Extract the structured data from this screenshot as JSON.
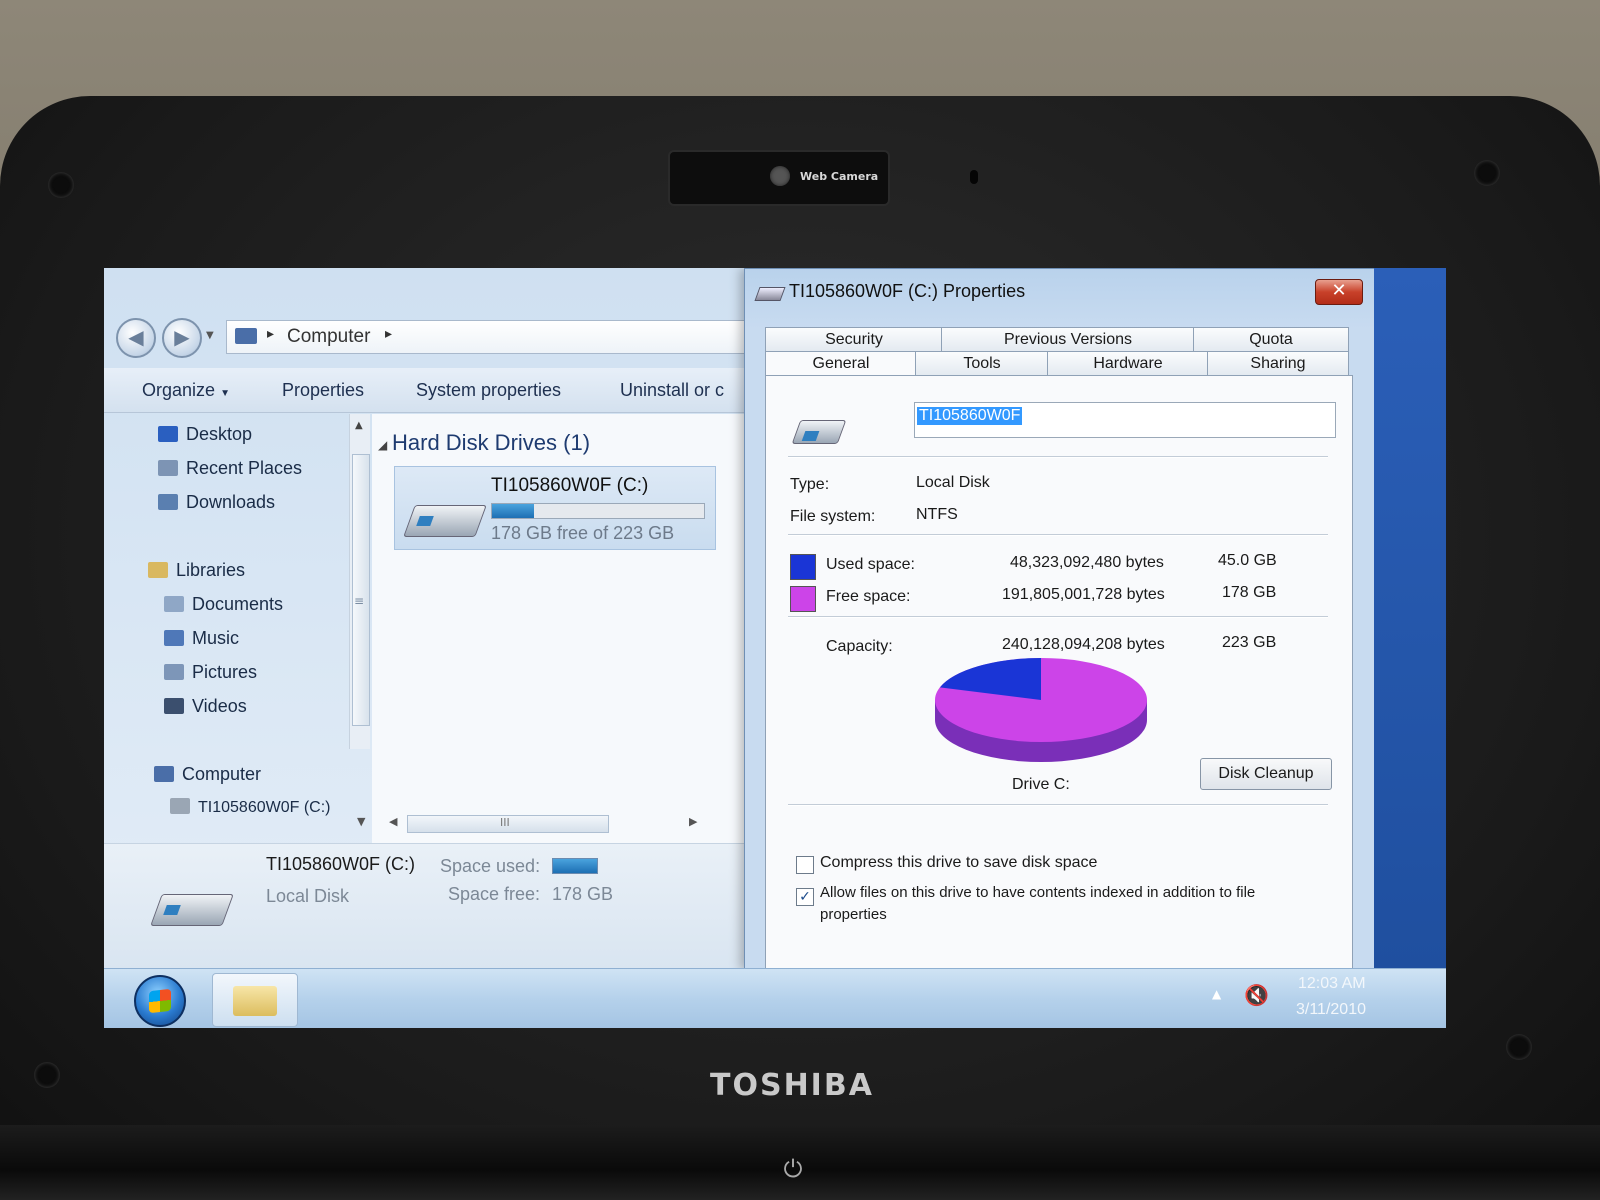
{
  "hardware": {
    "webcam_label": "Web Camera",
    "brand": "TOSHIBA"
  },
  "explorer": {
    "address": {
      "crumb": "Computer"
    },
    "commands": [
      "Organize",
      "Properties",
      "System properties",
      "Uninstall or c"
    ],
    "nav": {
      "favorites": [
        "Desktop",
        "Recent Places",
        "Downloads"
      ],
      "libraries_label": "Libraries",
      "libraries": [
        "Documents",
        "Music",
        "Pictures",
        "Videos"
      ],
      "computer_label": "Computer",
      "computer_drive": "TI105860W0F (C:)"
    },
    "group_title": "Hard Disk Drives (1)",
    "drive": {
      "name": "TI105860W0F (C:)",
      "free_text": "178 GB free of 223 GB",
      "used_fraction": 0.2
    },
    "hscroll_grip": "III",
    "details": {
      "name": "TI105860W0F (C:)",
      "type": "Local Disk",
      "space_used_label": "Space used:",
      "space_free_label": "Space free:",
      "space_free_value": "178 GB"
    }
  },
  "dialog": {
    "title": "TI105860W0F (C:) Properties",
    "close_label": "✕",
    "tabs_top": [
      "Security",
      "Previous Versions",
      "Quota"
    ],
    "tabs_bottom": [
      "General",
      "Tools",
      "Hardware",
      "Sharing"
    ],
    "active_tab": "General",
    "name_value": "TI105860W0F",
    "type_label": "Type:",
    "type_value": "Local Disk",
    "fs_label": "File system:",
    "fs_value": "NTFS",
    "used_label": "Used space:",
    "used_bytes": "48,323,092,480 bytes",
    "used_gb": "45.0 GB",
    "free_label": "Free space:",
    "free_bytes": "191,805,001,728 bytes",
    "free_gb": "178 GB",
    "capacity_label": "Capacity:",
    "capacity_bytes": "240,128,094,208 bytes",
    "capacity_gb": "223 GB",
    "drive_label": "Drive C:",
    "disk_cleanup": "Disk Cleanup",
    "compress_label": "Compress this drive to save disk space",
    "compress_checked": false,
    "index_label_1": "Allow files on this drive to have contents indexed in addition to file",
    "index_label_2": "properties",
    "index_checked": true,
    "colors": {
      "used": "#1a35d6",
      "free": "#cc44e8"
    },
    "used_fraction": 0.2012
  },
  "taskbar": {
    "time": "12:03 AM",
    "date": "3/11/2010"
  }
}
